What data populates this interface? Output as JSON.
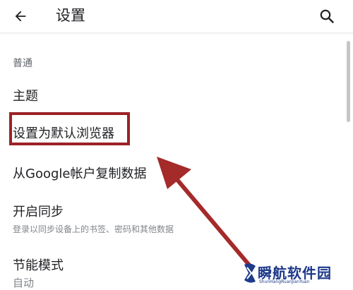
{
  "header": {
    "back_icon": "arrow-left-icon",
    "title": "设置",
    "search_icon": "search-icon"
  },
  "section": {
    "label": "普通"
  },
  "items": [
    {
      "label": "主题",
      "sublabel": ""
    },
    {
      "label": "设置为默认浏览器",
      "sublabel": ""
    },
    {
      "label": "从Google帐户复制数据",
      "sublabel": ""
    },
    {
      "label": "开启同步",
      "sublabel": "登录以同步设备上的书签、密码和其他数据"
    },
    {
      "label": "节能模式",
      "sublabel": "自动"
    }
  ],
  "annotation": {
    "box_color": "#9b2226",
    "arrow_color": "#a52a2a"
  },
  "watermark": {
    "text": "瞬航软件园",
    "subtext": "ShunHangRuanJianYuan",
    "color": "#1e3a8a"
  }
}
